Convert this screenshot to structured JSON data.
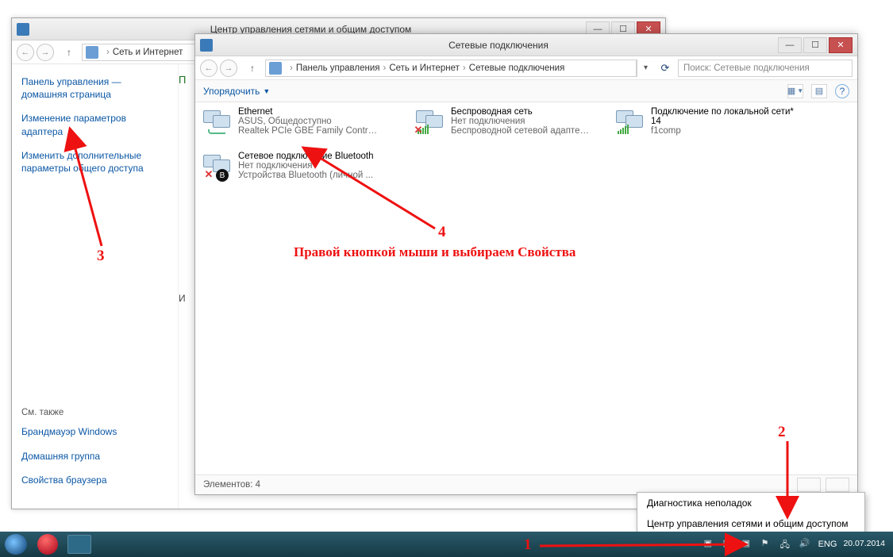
{
  "backWindow": {
    "title": "Центр управления сетями и общим доступом",
    "breadcrumb": "Сеть и Интернет",
    "side": {
      "home": "Панель управления — домашняя страница",
      "adapter": "Изменение параметров адаптера",
      "sharing": "Изменить дополнительные параметры общего доступа",
      "seealso": "См. также",
      "firewall": "Брандмауэр Windows",
      "homegroup": "Домашняя группа",
      "browser": "Свойства браузера"
    },
    "main": {
      "heading": "П",
      "info": "И"
    }
  },
  "frontWindow": {
    "title": "Сетевые подключения",
    "breadcrumb": {
      "a": "Панель управления",
      "b": "Сеть и Интернет",
      "c": "Сетевые подключения"
    },
    "searchPlaceholder": "Поиск: Сетевые подключения",
    "organize": "Упорядочить",
    "connections": {
      "eth": {
        "name": "Ethernet",
        "sub1": "ASUS, Общедоступно",
        "sub2": "Realtek PCIe GBE Family Controller"
      },
      "wifi": {
        "name": "Беспроводная сеть",
        "sub1": "Нет подключения",
        "sub2": "Беспроводной сетевой адаптер ..."
      },
      "local": {
        "name": "Подключение по локальной сети* 14",
        "sub2": "f1comp"
      },
      "bt": {
        "name": "Сетевое подключение Bluetooth",
        "sub1": "Нет подключения",
        "sub2": "Устройства Bluetooth (личной ..."
      }
    },
    "status": "Элементов: 4"
  },
  "contextMenu": {
    "diag": "Диагностика неполадок",
    "center": "Центр управления сетями и общим доступом"
  },
  "taskbar": {
    "lang": "ENG",
    "date": "20.07.2014"
  },
  "annotations": {
    "num1": "1",
    "num2": "2",
    "num3": "3",
    "num4": "4",
    "text": "Правой кнопкой мыши и выбираем Свойства"
  }
}
